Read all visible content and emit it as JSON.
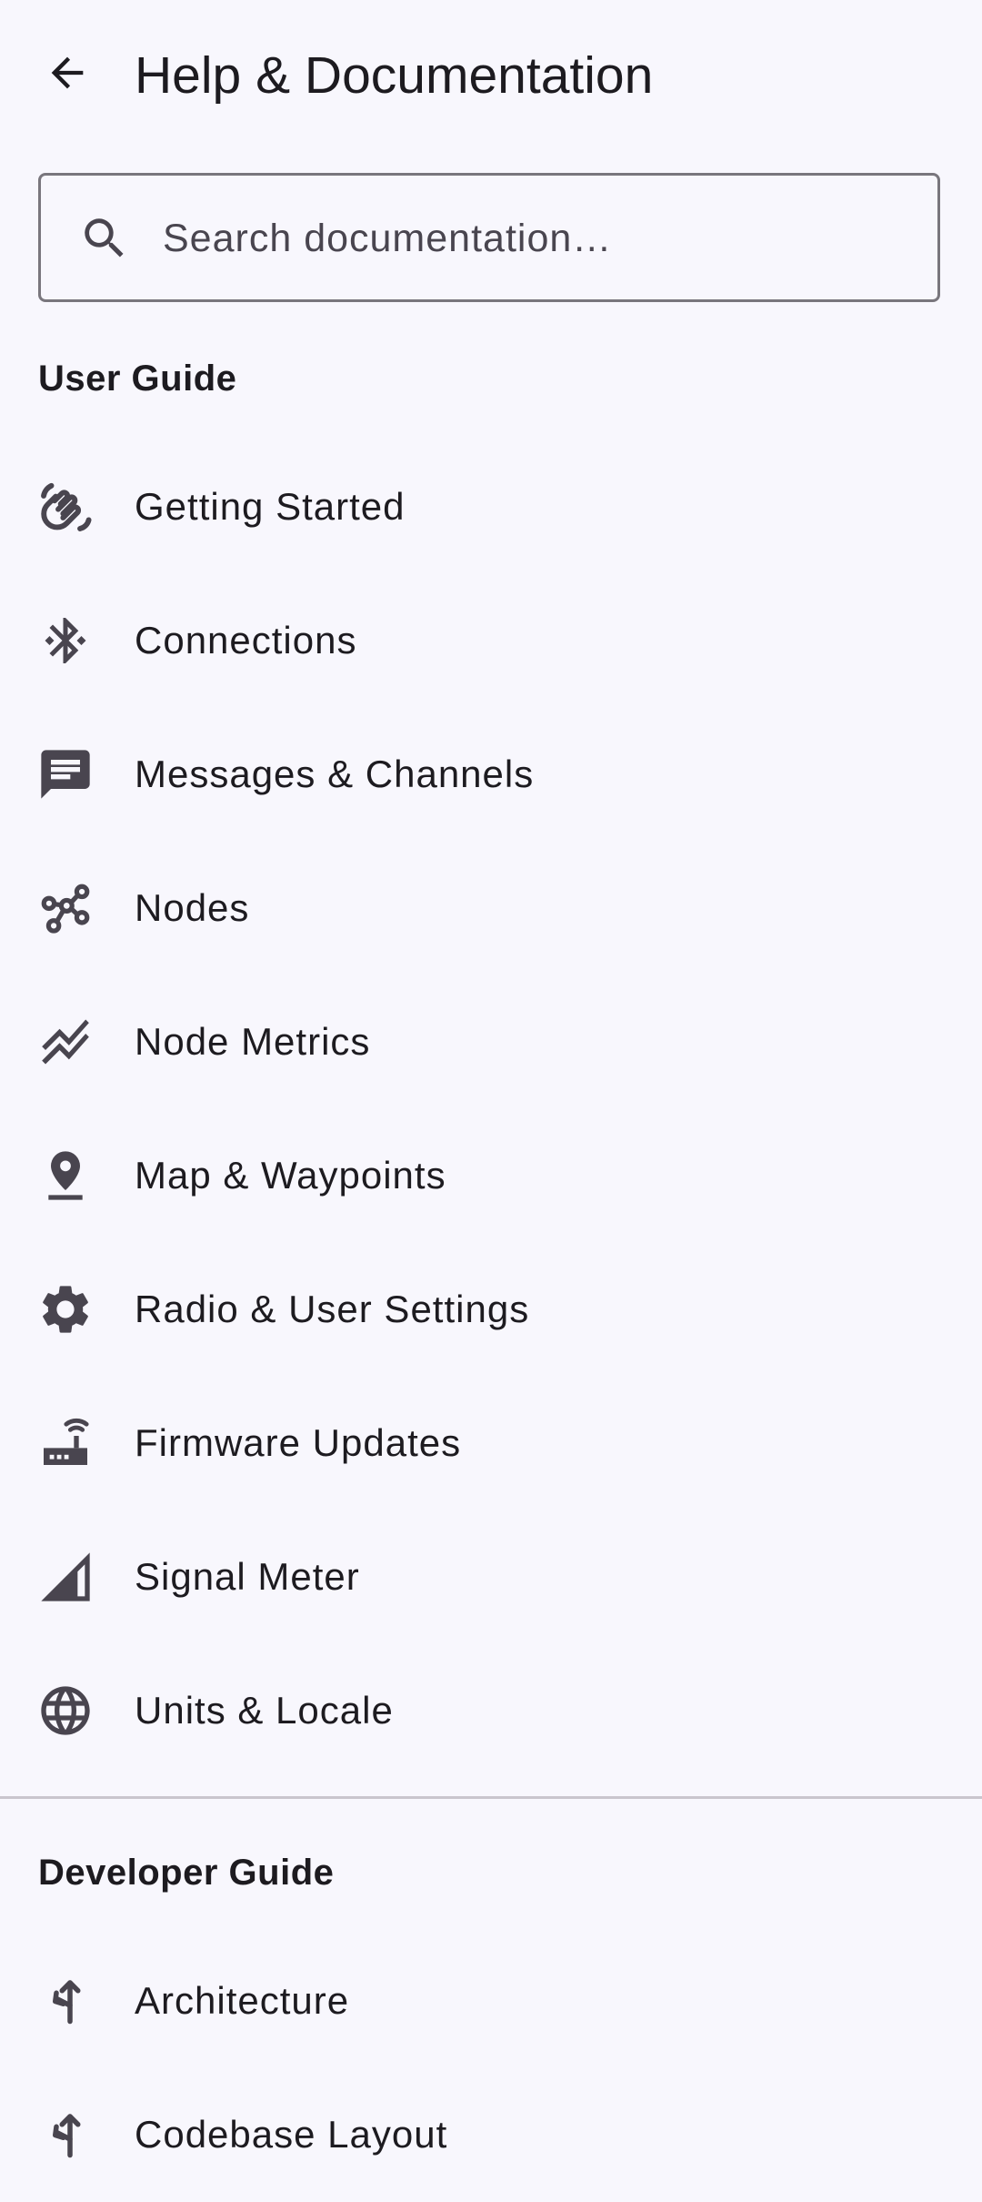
{
  "header": {
    "title": "Help & Documentation",
    "back_icon": "arrow-back-icon"
  },
  "search": {
    "placeholder": "Search documentation…",
    "value": "",
    "icon": "search-icon"
  },
  "user_guide": {
    "title": "User Guide",
    "items": [
      {
        "label": "Getting Started",
        "icon": "waving-hand-icon"
      },
      {
        "label": "Connections",
        "icon": "bluetooth-icon"
      },
      {
        "label": "Messages & Channels",
        "icon": "chat-icon"
      },
      {
        "label": "Nodes",
        "icon": "nodes-icon"
      },
      {
        "label": "Node Metrics",
        "icon": "stacked-line-chart-icon"
      },
      {
        "label": "Map & Waypoints",
        "icon": "location-pin-icon"
      },
      {
        "label": "Radio & User Settings",
        "icon": "gear-icon"
      },
      {
        "label": "Firmware Updates",
        "icon": "router-icon"
      },
      {
        "label": "Signal Meter",
        "icon": "signal-cellular-icon"
      },
      {
        "label": "Units & Locale",
        "icon": "globe-icon"
      }
    ]
  },
  "developer_guide": {
    "title": "Developer Guide",
    "items": [
      {
        "label": "Architecture",
        "icon": "fork-left-icon"
      },
      {
        "label": "Codebase Layout",
        "icon": "fork-left-icon"
      }
    ]
  },
  "colors": {
    "background": "#f8f7fd",
    "text": "#1d1b20",
    "icon": "#49454f",
    "outline": "#79767d",
    "divider": "#c9c5cd"
  }
}
